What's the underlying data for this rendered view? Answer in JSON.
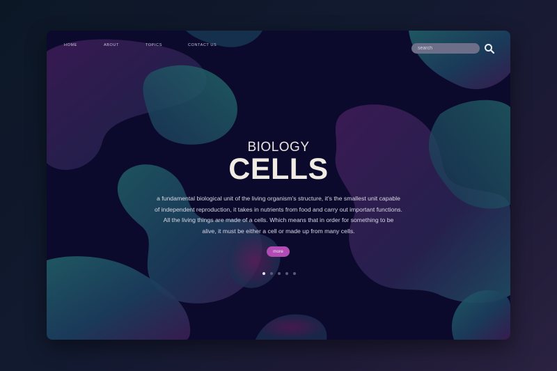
{
  "nav": {
    "items": [
      {
        "label": "HOME"
      },
      {
        "label": "ABOUT"
      },
      {
        "label": "TOPICS"
      },
      {
        "label": "CONTACT US"
      }
    ]
  },
  "search": {
    "placeholder": "search",
    "icon": "search-icon"
  },
  "hero": {
    "subtitle": "BIOLOGY",
    "title": "CELLS",
    "description_lines": [
      "a fundamental biological unit of the living organism's structure, it's the smallest unit capable",
      "of independent reproduction, it takes in nutrients from food and carry out important functions.",
      "All the living things are made of a cells. Which means that in order for something to be",
      "alive, it must be either a cell or made up from many cells."
    ],
    "more_label": "more"
  },
  "carousel": {
    "count": 5,
    "active_index": 0
  },
  "colors": {
    "window_bg": "#0b0a2c",
    "accent": "#b24bb4",
    "blob_teal": "#1f5e66",
    "blob_purple": "#4a1c57",
    "text_light": "#f0ebe3"
  }
}
